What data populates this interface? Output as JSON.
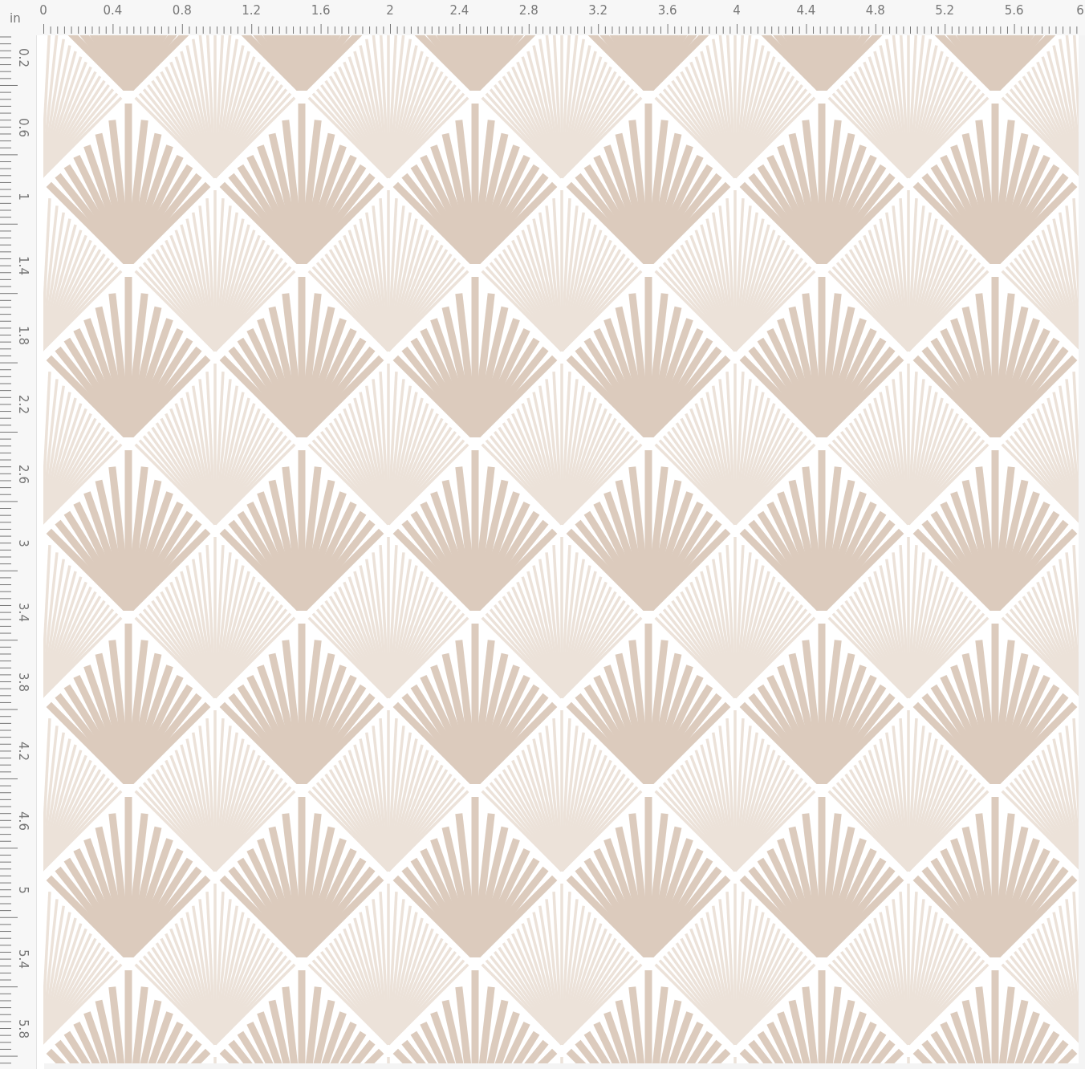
{
  "ruler": {
    "unit": "in",
    "top_labels": [
      "0",
      "0.4",
      "0.8",
      "1.2",
      "1.6",
      "2",
      "2.4",
      "2.8",
      "3.2",
      "3.6",
      "4",
      "4.4",
      "4.8",
      "5.2",
      "5.6",
      "6"
    ],
    "left_labels": [
      "0.2",
      "0.6",
      "1",
      "1.4",
      "1.8",
      "2.2",
      "2.6",
      "3",
      "3.4",
      "3.8",
      "4.2",
      "4.6",
      "5",
      "5.4",
      "5.8"
    ]
  }
}
